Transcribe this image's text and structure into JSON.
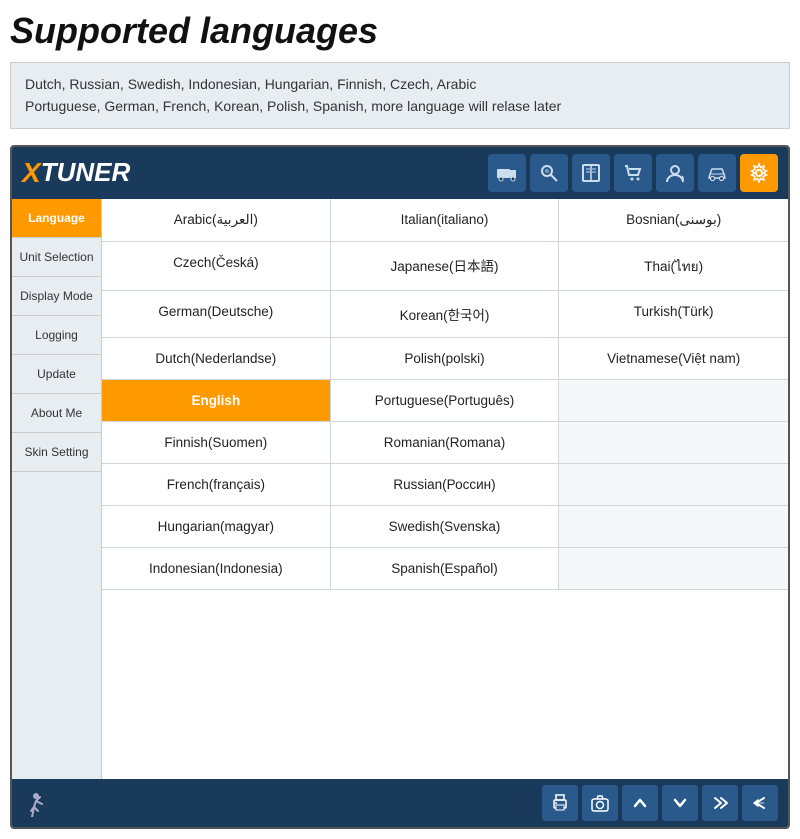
{
  "page": {
    "title": "Supported languages",
    "description": "Dutch, Russian, Swedish, Indonesian, Hungarian, Finnish, Czech, Arabic\nPortuguese, German, French, Korean, Polish, Spanish, more language will relase later"
  },
  "app": {
    "logo_x": "X",
    "logo_tuner": "TUNER"
  },
  "sidebar": {
    "items": [
      {
        "label": "Language",
        "active": true
      },
      {
        "label": "Unit Selection",
        "active": false
      },
      {
        "label": "Display Mode",
        "active": false
      },
      {
        "label": "Logging",
        "active": false
      },
      {
        "label": "Update",
        "active": false
      },
      {
        "label": "About Me",
        "active": false
      },
      {
        "label": "Skin Setting",
        "active": false
      }
    ]
  },
  "languages": {
    "cells": [
      {
        "text": "Arabic(العربية)",
        "selected": false,
        "empty": false
      },
      {
        "text": "Italian(italiano)",
        "selected": false,
        "empty": false
      },
      {
        "text": "Bosnian(بوسنی)",
        "selected": false,
        "empty": false
      },
      {
        "text": "Czech(Česká)",
        "selected": false,
        "empty": false
      },
      {
        "text": "Japanese(日本語)",
        "selected": false,
        "empty": false
      },
      {
        "text": "Thai(ไทย)",
        "selected": false,
        "empty": false
      },
      {
        "text": "German(Deutsche)",
        "selected": false,
        "empty": false
      },
      {
        "text": "Korean(한국어)",
        "selected": false,
        "empty": false
      },
      {
        "text": "Turkish(Türk)",
        "selected": false,
        "empty": false
      },
      {
        "text": "Dutch(Nederlandse)",
        "selected": false,
        "empty": false
      },
      {
        "text": "Polish(polski)",
        "selected": false,
        "empty": false
      },
      {
        "text": "Vietnamese(Việt nam)",
        "selected": false,
        "empty": false
      },
      {
        "text": "English",
        "selected": true,
        "empty": false
      },
      {
        "text": "Portuguese(Português)",
        "selected": false,
        "empty": false
      },
      {
        "text": "",
        "selected": false,
        "empty": true
      },
      {
        "text": "Finnish(Suomen)",
        "selected": false,
        "empty": false
      },
      {
        "text": "Romanian(Romana)",
        "selected": false,
        "empty": false
      },
      {
        "text": "",
        "selected": false,
        "empty": true
      },
      {
        "text": "French(français)",
        "selected": false,
        "empty": false
      },
      {
        "text": "Russian(Россин)",
        "selected": false,
        "empty": false
      },
      {
        "text": "",
        "selected": false,
        "empty": true
      },
      {
        "text": "Hungarian(magyar)",
        "selected": false,
        "empty": false
      },
      {
        "text": "Swedish(Svenska)",
        "selected": false,
        "empty": false
      },
      {
        "text": "",
        "selected": false,
        "empty": true
      },
      {
        "text": "Indonesian(Indonesia)",
        "selected": false,
        "empty": false
      },
      {
        "text": "Spanish(Español)",
        "selected": false,
        "empty": false
      },
      {
        "text": "",
        "selected": false,
        "empty": true
      }
    ]
  }
}
